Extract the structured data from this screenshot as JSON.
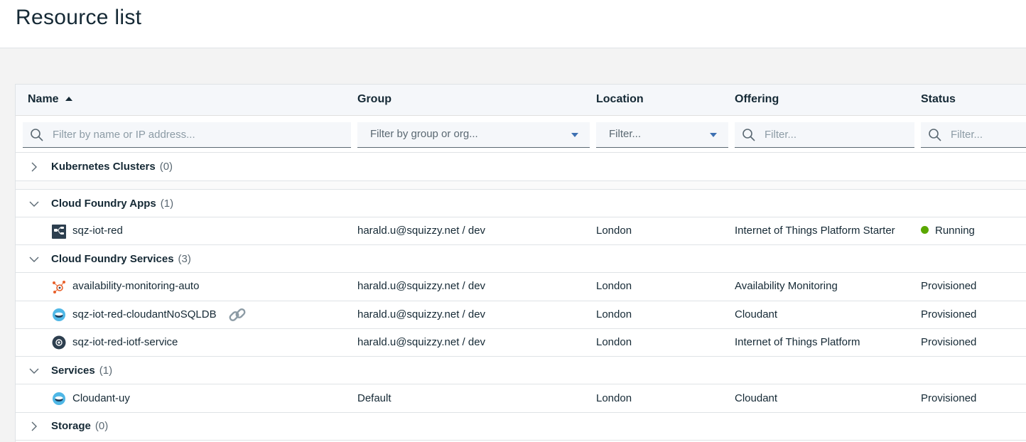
{
  "page": {
    "title": "Resource list"
  },
  "table": {
    "columns": {
      "name": "Name",
      "group": "Group",
      "location": "Location",
      "offering": "Offering",
      "status": "Status"
    },
    "sort": {
      "column": "Name",
      "direction": "ascending"
    },
    "filters": {
      "name_placeholder": "Filter by name or IP address...",
      "group_selected": "Filter by group or org...",
      "location_selected": "Filter...",
      "offering_placeholder": "Filter...",
      "status_placeholder": "Filter..."
    },
    "groups": [
      {
        "name": "Kubernetes Clusters",
        "count": "(0)",
        "expanded": false,
        "rows": []
      },
      {
        "name": "Cloud Foundry Apps",
        "count": "(1)",
        "expanded": true,
        "rows": [
          {
            "name": "sqz-iot-red",
            "icon": "node-red-app-icon",
            "group": "harald.u@squizzy.net / dev",
            "location": "London",
            "offering": "Internet of Things Platform Starter",
            "status": "Running",
            "status_color": "#5aa700"
          }
        ]
      },
      {
        "name": "Cloud Foundry Services",
        "count": "(3)",
        "expanded": true,
        "rows": [
          {
            "name": "availability-monitoring-auto",
            "icon": "availability-monitoring-icon",
            "group": "harald.u@squizzy.net / dev",
            "location": "London",
            "offering": "Availability Monitoring",
            "status": "Provisioned"
          },
          {
            "name": "sqz-iot-red-cloudantNoSQLDB",
            "icon": "cloudant-icon",
            "aliased": true,
            "group": "harald.u@squizzy.net / dev",
            "location": "London",
            "offering": "Cloudant",
            "status": "Provisioned"
          },
          {
            "name": "sqz-iot-red-iotf-service",
            "icon": "iot-platform-icon",
            "group": "harald.u@squizzy.net / dev",
            "location": "London",
            "offering": "Internet of Things Platform",
            "status": "Provisioned"
          }
        ]
      },
      {
        "name": "Services",
        "count": "(1)",
        "expanded": true,
        "rows": [
          {
            "name": "Cloudant-uy",
            "icon": "cloudant-icon",
            "group": "Default",
            "location": "London",
            "offering": "Cloudant",
            "status": "Provisioned"
          }
        ]
      },
      {
        "name": "Storage",
        "count": "(0)",
        "expanded": false,
        "rows": []
      }
    ]
  },
  "colors": {
    "running": "#5aa700",
    "accent": "#3d70b2"
  }
}
